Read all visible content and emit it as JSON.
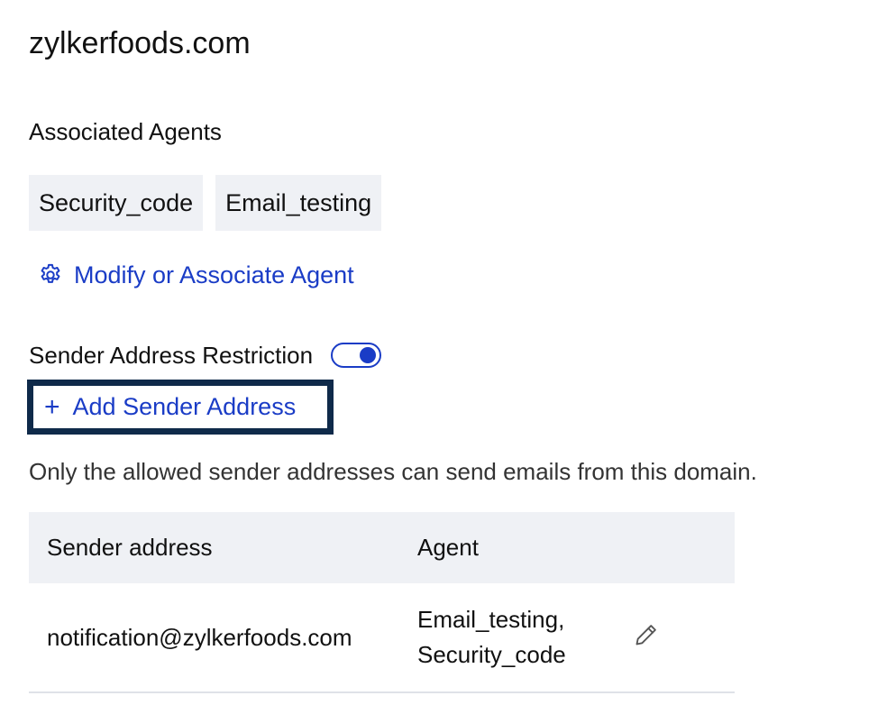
{
  "domain": {
    "title": "zylkerfoods.com"
  },
  "associated_agents": {
    "heading": "Associated Agents",
    "chips": [
      "Security_code",
      "Email_testing"
    ],
    "modify_link": "Modify or Associate Agent",
    "modify_icon": "gear-icon"
  },
  "sender_restriction": {
    "label": "Sender Address Restriction",
    "enabled": true,
    "add_button_icon": "plus-icon",
    "add_button_label": "Add Sender Address",
    "note": "Only the allowed sender addresses can send emails from this domain."
  },
  "table": {
    "headers": {
      "sender_address": "Sender address",
      "agent": "Agent"
    },
    "rows": [
      {
        "sender_address": "notification@zylkerfoods.com",
        "agent_line1": "Email_testing,",
        "agent_line2": "Security_code",
        "action_icon": "pencil-icon"
      }
    ]
  },
  "colors": {
    "accent": "#1a3cc6",
    "focus_border": "#0f2a4a",
    "chip_bg": "#eff1f5",
    "header_bg": "#eff1f5"
  }
}
